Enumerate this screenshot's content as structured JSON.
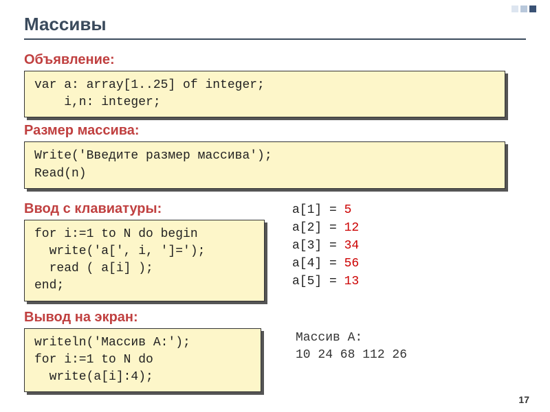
{
  "title": "Массивы",
  "sections": {
    "declaration": {
      "label": "Объявление:",
      "code": "var a: array[1..25] of integer;\n    i,n: integer;"
    },
    "size": {
      "label": "Размер массива:",
      "code": "Write('Введите размер массива');\nRead(n)"
    },
    "input": {
      "label": "Ввод с клавиатуры:",
      "code": "for i:=1 to N do begin\n  write('a[', i, ']=');\n  read ( a[i] );\nend;"
    },
    "output": {
      "label": "Вывод на экран:",
      "code": "writeln('Массив A:');\nfor i:=1 to N do \n  write(a[i]:4);"
    }
  },
  "array_samples": [
    {
      "label": "a[1] =",
      "value": "5"
    },
    {
      "label": "a[2] =",
      "value": "12"
    },
    {
      "label": "a[3] =",
      "value": "34"
    },
    {
      "label": "a[4] =",
      "value": "56"
    },
    {
      "label": "a[5] =",
      "value": "13"
    }
  ],
  "screen_output": {
    "title": "Массив A:",
    "values": "  10  24  68 112  26"
  },
  "page": "17"
}
